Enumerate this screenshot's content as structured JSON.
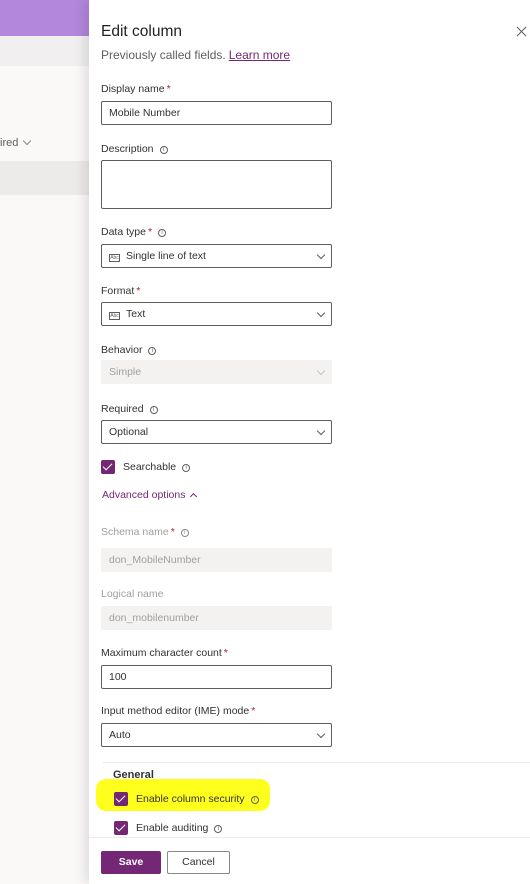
{
  "background": {
    "required_text": "ired"
  },
  "panel": {
    "title": "Edit column",
    "subtitle": "Previously called fields.",
    "learn_more": "Learn more"
  },
  "fields": {
    "display_name": {
      "label": "Display name",
      "required_mark": "*",
      "value": "Mobile Number"
    },
    "description": {
      "label": "Description",
      "value": ""
    },
    "data_type": {
      "label": "Data type",
      "required_mark": "*",
      "value": "Single line of text",
      "icon": "text-field-icon",
      "icon_text": "Abc"
    },
    "format": {
      "label": "Format",
      "required_mark": "*",
      "value": "Text",
      "icon": "text-field-icon",
      "icon_text": "Abc"
    },
    "behavior": {
      "label": "Behavior",
      "value": "Simple"
    },
    "required": {
      "label": "Required",
      "value": "Optional"
    },
    "searchable": {
      "label": "Searchable",
      "checked": true
    },
    "advanced_options": {
      "label": "Advanced options"
    },
    "schema_name": {
      "label": "Schema name",
      "required_mark": "*",
      "value": "don_MobileNumber"
    },
    "logical_name": {
      "label": "Logical name",
      "value": "don_mobilenumber"
    },
    "max_char_count": {
      "label": "Maximum character count",
      "required_mark": "*",
      "value": "100"
    },
    "ime_mode": {
      "label": "Input method editor (IME) mode",
      "required_mark": "*",
      "value": "Auto"
    }
  },
  "general": {
    "title": "General",
    "enable_column_security": {
      "label": "Enable column security",
      "checked": true
    },
    "enable_auditing": {
      "label": "Enable auditing",
      "checked": true
    }
  },
  "footer": {
    "save_label": "Save",
    "cancel_label": "Cancel"
  },
  "info_glyph": "i",
  "colors": {
    "accent": "#742774",
    "highlight": "#ffff1e",
    "required": "#a4262c"
  }
}
